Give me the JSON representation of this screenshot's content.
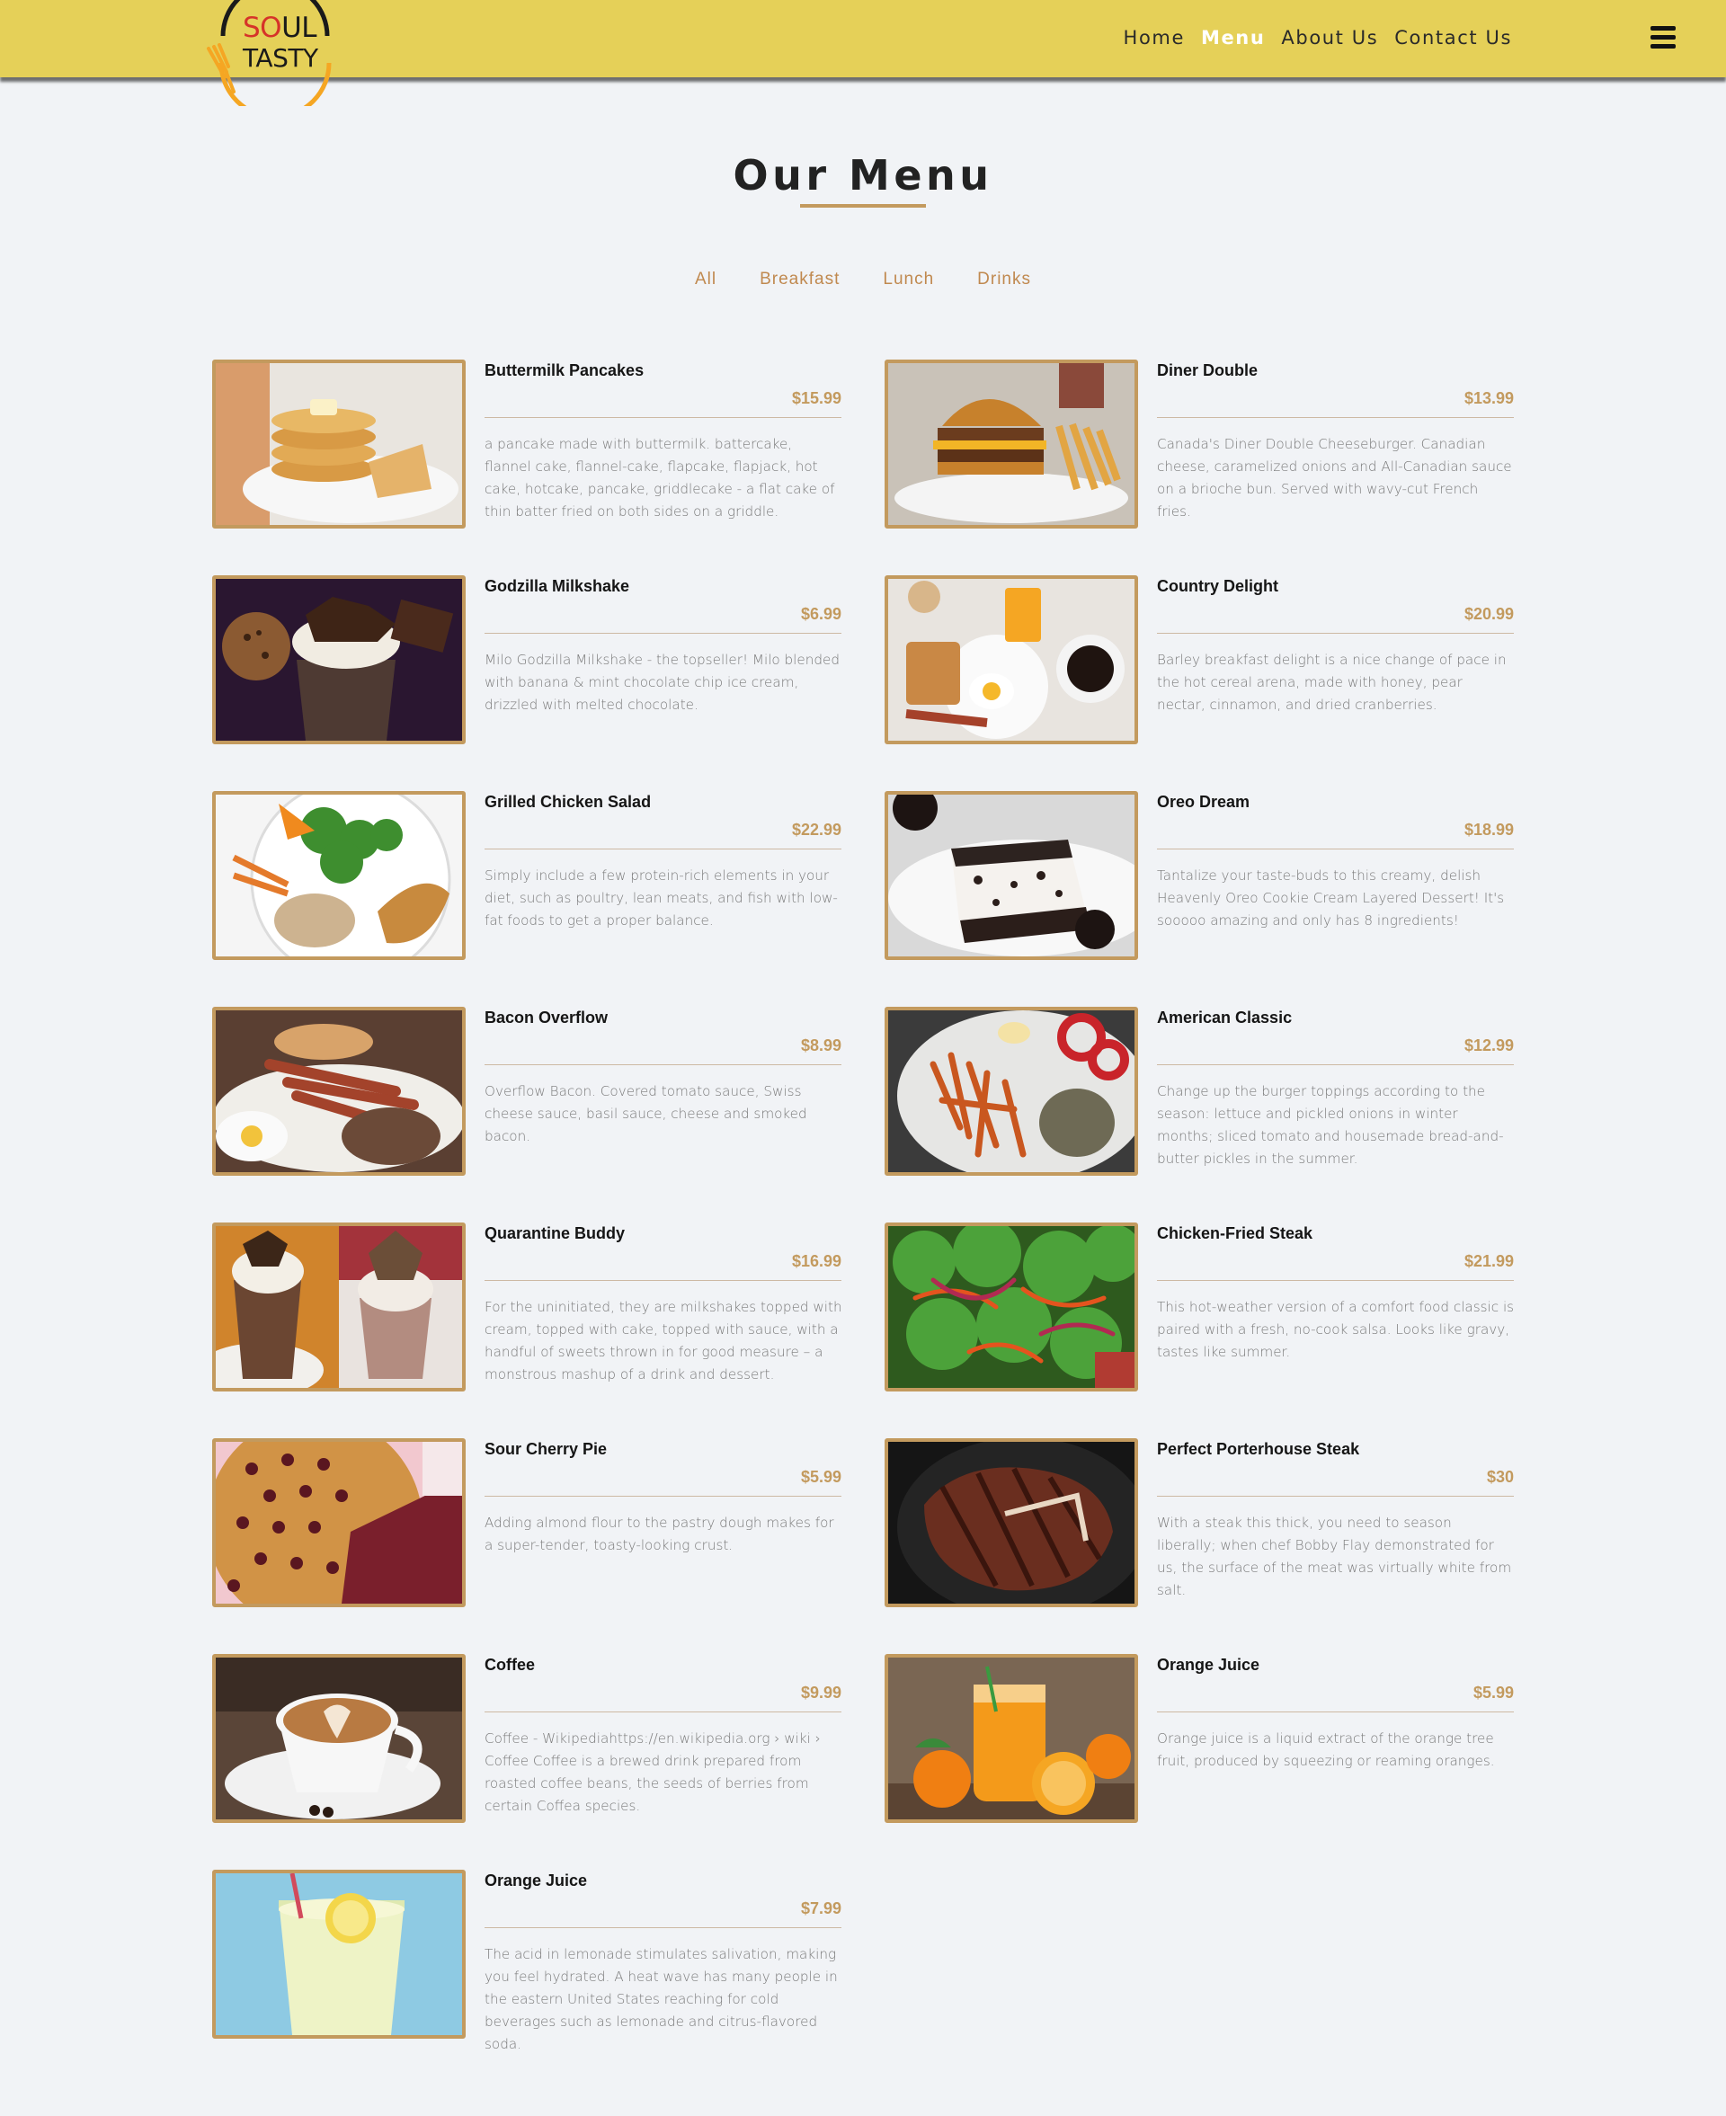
{
  "brand": {
    "logo_word1_red": "SO",
    "logo_word1_dark": "UL",
    "logo_word2": "TASTY"
  },
  "nav": {
    "items": [
      {
        "label": "Home",
        "active": false
      },
      {
        "label": "Menu",
        "active": true
      },
      {
        "label": "About Us",
        "active": false
      },
      {
        "label": "Contact Us",
        "active": false
      }
    ],
    "menu_icon": "hamburger-icon"
  },
  "page": {
    "title": "Our Menu"
  },
  "filters": [
    "All",
    "Breakfast",
    "Lunch",
    "Drinks"
  ],
  "colors": {
    "header": "#e5d058",
    "accent": "#c39a5e",
    "background": "#f1f3f6"
  },
  "items": [
    {
      "name": "Buttermilk Pancakes",
      "price": "$15.99",
      "image": "pancakes-photo",
      "desc": "a pancake made with buttermilk. battercake, flannel cake, flannel-cake, flapcake, flapjack, hot cake, hotcake, pancake, griddlecake - a flat cake of thin batter fried on both sides on a griddle."
    },
    {
      "name": "Diner Double",
      "price": "$13.99",
      "image": "burger-photo",
      "desc": "Canada's Diner Double Cheeseburger. Canadian cheese, caramelized onions and All-Canadian sauce on a brioche bun. Served with wavy-cut French fries."
    },
    {
      "name": "Godzilla Milkshake",
      "price": "$6.99",
      "image": "milkshake-photo",
      "desc": "Milo Godzilla Milkshake - the topseller! Milo blended with banana & mint chocolate chip ice cream, drizzled with melted chocolate."
    },
    {
      "name": "Country Delight",
      "price": "$20.99",
      "image": "breakfast-photo",
      "desc": "Barley breakfast delight is a nice change of pace in the hot cereal arena, made with honey, pear nectar, cinnamon, and dried cranberries."
    },
    {
      "name": "Grilled Chicken Salad",
      "price": "$22.99",
      "image": "chicken-salad-photo",
      "desc": "Simply include a few protein-rich elements in your diet, such as poultry, lean meats, and fish with low-fat foods to get a proper balance."
    },
    {
      "name": "Oreo Dream",
      "price": "$18.99",
      "image": "oreo-cake-photo",
      "desc": "Tantalize your taste-buds to this creamy, delish Heavenly Oreo Cookie Cream Layered Dessert! It's sooooo amazing and only has 8 ingredients!"
    },
    {
      "name": "Bacon Overflow",
      "price": "$8.99",
      "image": "bacon-plate-photo",
      "desc": "Overflow Bacon. Covered tomato sauce, Swiss cheese sauce, basil sauce, cheese and smoked bacon."
    },
    {
      "name": "American Classic",
      "price": "$12.99",
      "image": "fries-plate-photo",
      "desc": "Change up the burger toppings according to the season: lettuce and pickled onions in winter months; sliced tomato and housemade bread-and-butter pickles in the summer."
    },
    {
      "name": "Quarantine Buddy",
      "price": "$16.99",
      "image": "freakshake-photo",
      "desc": "For the uninitiated, they are milkshakes topped with cream, topped with cake, topped with sauce, with a handful of sweets thrown in for good measure – a monstrous mashup of a drink and dessert."
    },
    {
      "name": "Chicken-Fried Steak",
      "price": "$21.99",
      "image": "green-salad-photo",
      "desc": "This hot-weather version of a comfort food classic is paired with a fresh, no-cook salsa. Looks like gravy, tastes like summer."
    },
    {
      "name": "Sour Cherry Pie",
      "price": "$5.99",
      "image": "cherry-pie-photo",
      "desc": "Adding almond flour to the pastry dough makes for a super-tender, toasty-looking crust."
    },
    {
      "name": "Perfect Porterhouse Steak",
      "price": "$30",
      "image": "steak-photo",
      "desc": "With a steak this thick, you need to season liberally; when chef Bobby Flay demonstrated for us, the surface of the meat was virtually white from salt."
    },
    {
      "name": "Coffee",
      "price": "$9.99",
      "image": "coffee-photo",
      "desc": "Coffee - Wikipediahttps://en.wikipedia.org › wiki › Coffee Coffee is a brewed drink prepared from roasted coffee beans, the seeds of berries from certain Coffea species."
    },
    {
      "name": "Orange Juice",
      "price": "$5.99",
      "image": "orange-juice-photo",
      "desc": "Orange juice is a liquid extract of the orange tree fruit, produced by squeezing or reaming oranges."
    },
    {
      "name": "Orange Juice",
      "price": "$7.99",
      "image": "lemonade-photo",
      "desc": "The acid in lemonade stimulates salivation, making you feel hydrated. A heat wave has many people in the eastern United States reaching for cold beverages such as lemonade and citrus-flavored soda."
    }
  ]
}
